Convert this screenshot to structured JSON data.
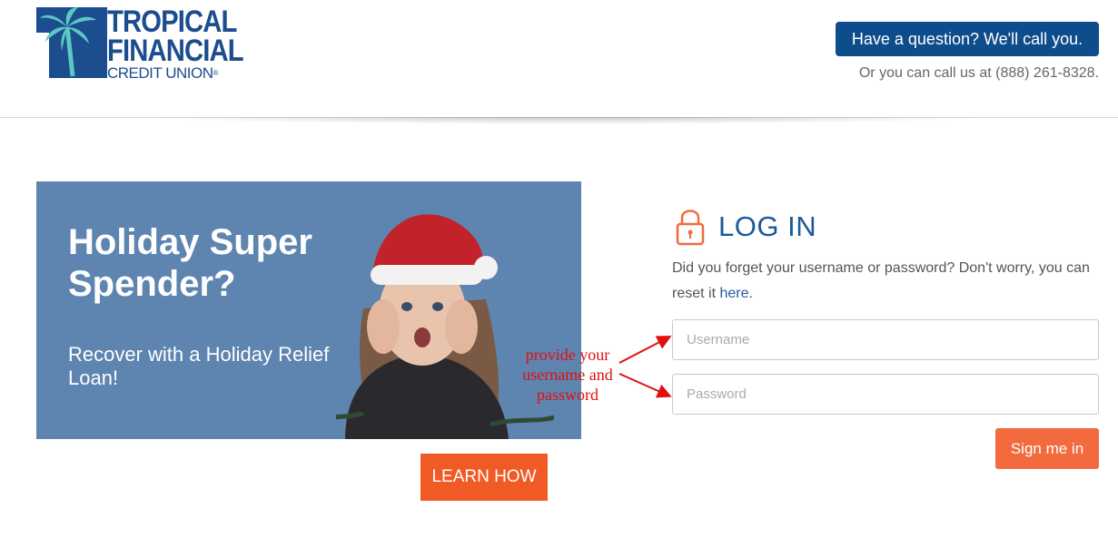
{
  "header": {
    "logo": {
      "line1": "TROPICAL",
      "line2": "FINANCIAL",
      "line3": "CREDIT UNION",
      "reg": "®"
    },
    "callback_button": "Have a question? We'll call you.",
    "phone_text": "Or you can call us at (888) 261-8328."
  },
  "banner": {
    "title": "Holiday Super Spender?",
    "subtitle": "Recover with a Holiday Relief Loan!",
    "cta": "LEARN HOW",
    "background_color": "#5e84b0",
    "cta_color": "#f05a24"
  },
  "login": {
    "icon": "lock-icon",
    "title": "LOG IN",
    "description_prefix": "Did you forget your username or password? Don't worry, you can reset it ",
    "description_link": "here",
    "description_suffix": ".",
    "username_placeholder": "Username",
    "password_placeholder": "Password",
    "signin_label": "Sign me in",
    "accent_color": "#1b5a9a",
    "button_color": "#f26a3d"
  },
  "annotation": {
    "text": "provide your username and password",
    "color": "#e01010"
  }
}
